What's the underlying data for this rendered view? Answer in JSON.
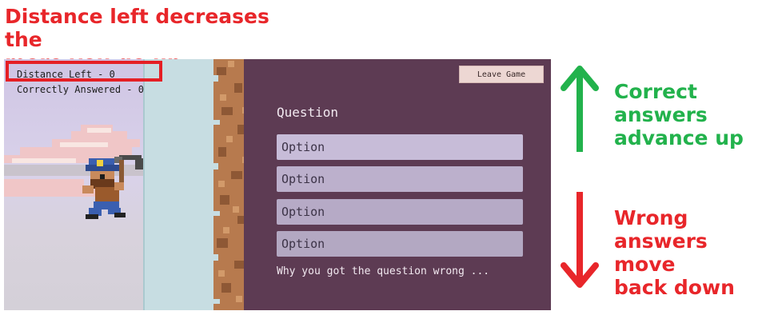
{
  "annotations": {
    "top_line1": "Distance left decreases the",
    "top_line2": "more you go up",
    "correct_line1": "Correct",
    "correct_line2": "answers",
    "correct_line3": "advance up",
    "wrong_line1": "Wrong",
    "wrong_line2": "answers move",
    "wrong_line3": "back down"
  },
  "hud": {
    "distance": "Distance Left - 0",
    "correctly_answered": "Correctly Answered - 0"
  },
  "panel": {
    "leave_button": "Leave Game",
    "question": "Question",
    "options": [
      "Option",
      "Option",
      "Option",
      "Option"
    ],
    "feedback": "Why you got the question wrong ..."
  },
  "colors": {
    "annotation_red": "#e8262a",
    "annotation_green": "#22b24c",
    "panel_bg": "#5d3b53",
    "option_bg": "#c9bdd9",
    "sky": "#d2cbe4",
    "ice": "#c7dde2",
    "rock": "#b77a4e"
  },
  "icons": {
    "up_arrow": "arrow-up-icon",
    "down_arrow": "arrow-down-icon",
    "character": "miner-character"
  }
}
